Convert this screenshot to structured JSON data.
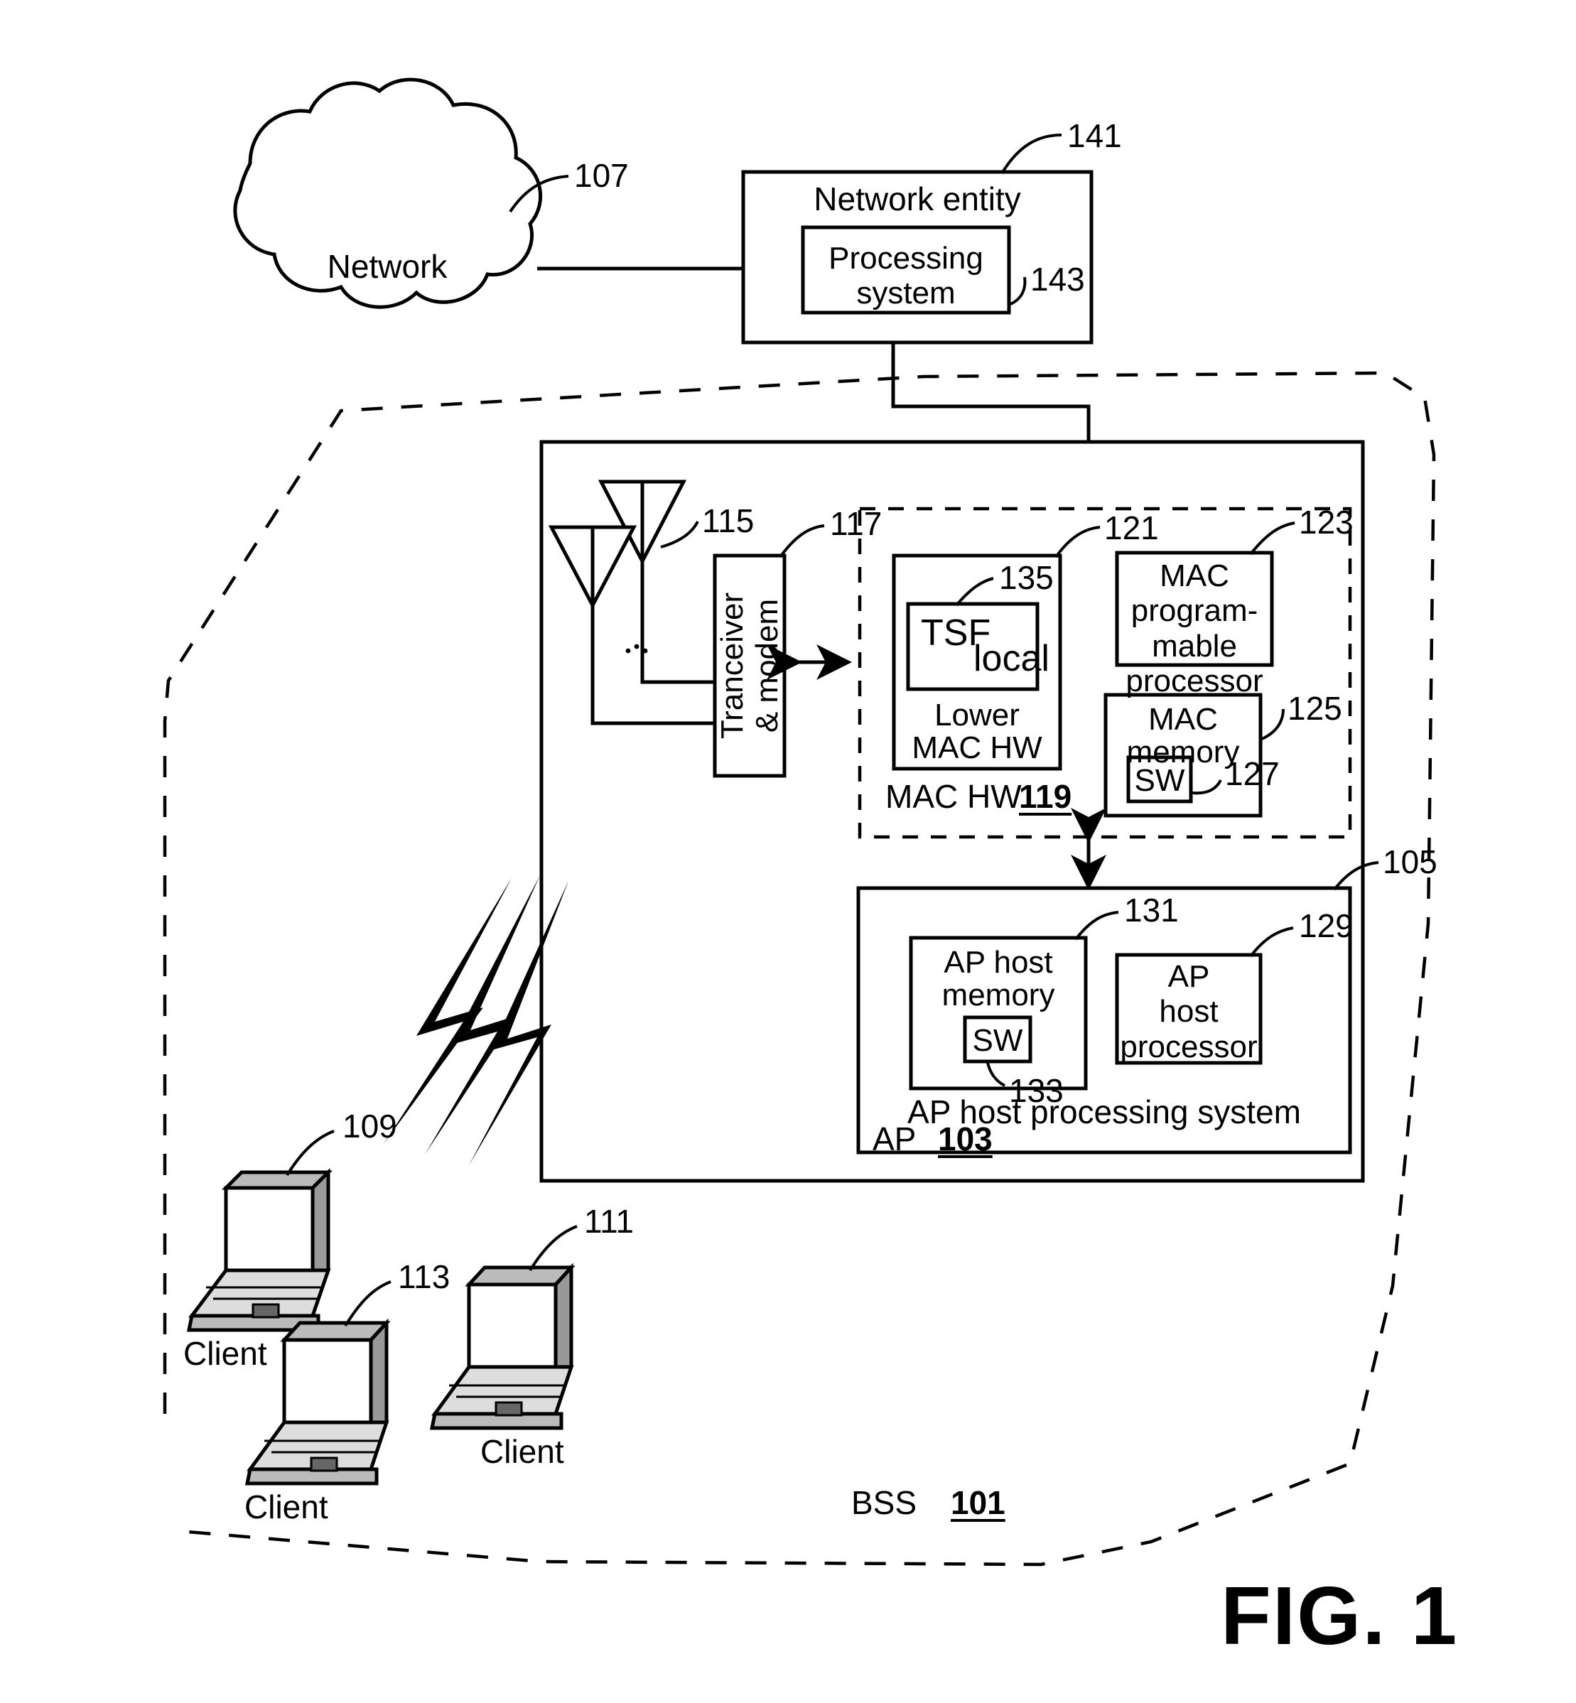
{
  "figure": {
    "caption": "FIG. 1",
    "domain_kind": "patent-block-diagram"
  },
  "nodes": {
    "network_cloud": {
      "label": "Network",
      "ref": "107"
    },
    "network_entity": {
      "label": "Network entity",
      "ref": "141"
    },
    "processing_system": {
      "label_line1": "Processing",
      "label_line2": "system",
      "ref": "143"
    },
    "antenna_primary": {
      "ref": "115",
      "icon": "antenna-icon"
    },
    "antenna_secondary": {
      "icon": "antenna-icon"
    },
    "transceiver": {
      "label": "Tranceiver\n& modem",
      "ref": "117"
    },
    "mac_hw_region": {
      "label": "MAC HW",
      "ref": "119"
    },
    "lower_mac_hw": {
      "label_line1": "Lower",
      "label_line2": "MAC HW",
      "ref": "121"
    },
    "tsf_local": {
      "label_main": "TSF",
      "label_sub": "local",
      "ref": "135"
    },
    "mac_programmable_processor": {
      "label": "MAC\nprogram-\nmable\nprocessor",
      "ref": "123"
    },
    "mac_memory": {
      "label_line1": "MAC",
      "label_line2": "memory",
      "ref": "125"
    },
    "mac_memory_sw": {
      "label": "SW",
      "ref": "127"
    },
    "ap_host_processing_system": {
      "label": "AP host processing system",
      "ref": "105"
    },
    "ap_host_memory": {
      "label_line1": "AP host",
      "label_line2": "memory",
      "ref": "131"
    },
    "ap_host_memory_sw": {
      "label": "SW",
      "ref": "133"
    },
    "ap_host_processor": {
      "label": "AP\nhost\nprocessor",
      "ref": "129"
    },
    "access_point": {
      "label": "AP",
      "ref": "103"
    },
    "bss": {
      "label": "BSS",
      "ref": "101"
    },
    "client_1": {
      "label": "Client",
      "ref": "109",
      "icon": "laptop-icon"
    },
    "client_2": {
      "label": "Client",
      "ref": "111",
      "icon": "laptop-icon"
    },
    "client_3": {
      "label": "Client",
      "ref": "113",
      "icon": "laptop-icon"
    },
    "wireless_link": {
      "icon": "lightning-bolt-icon",
      "count": 3
    }
  },
  "ref_numerals": [
    "101",
    "103",
    "105",
    "107",
    "109",
    "111",
    "113",
    "115",
    "117",
    "119",
    "121",
    "123",
    "125",
    "127",
    "129",
    "131",
    "133",
    "135",
    "141",
    "143"
  ],
  "colors": {
    "ink": "#000000",
    "paper": "#ffffff"
  }
}
